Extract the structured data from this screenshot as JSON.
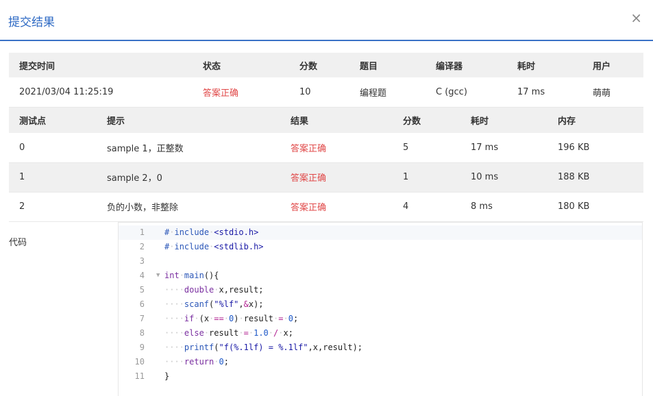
{
  "dialog": {
    "title": "提交结果",
    "close": "×"
  },
  "summary": {
    "headers": [
      "提交时间",
      "状态",
      "分数",
      "题目",
      "编译器",
      "耗时",
      "用户"
    ],
    "row": [
      "2021/03/04 11:25:19",
      "答案正确",
      "10",
      "编程题",
      "C (gcc)",
      "17 ms",
      "萌萌"
    ]
  },
  "cases": {
    "headers": [
      "测试点",
      "提示",
      "结果",
      "分数",
      "耗时",
      "内存"
    ],
    "rows": [
      [
        "0",
        "sample 1，正整数",
        "答案正确",
        "5",
        "17 ms",
        "196 KB"
      ],
      [
        "1",
        "sample 2，0",
        "答案正确",
        "1",
        "10 ms",
        "188 KB"
      ],
      [
        "2",
        "负的小数，非整除",
        "答案正确",
        "4",
        "8 ms",
        "180 KB"
      ]
    ]
  },
  "code": {
    "label": "代码",
    "lines": [
      "# include <stdio.h>",
      "# include <stdlib.h>",
      "",
      "int main(){",
      "    double x,result;",
      "    scanf(\"%lf\",&x);",
      "    if (x == 0) result = 0;",
      "    else result = 1.0 / x;",
      "    printf(\"f(%.1lf) = %.1lf\",x,result);",
      "    return 0;",
      "}"
    ]
  },
  "colors": {
    "accent": "#2e6ac4",
    "status_ok": "#e04848",
    "header_bg": "#f0f0f0"
  }
}
